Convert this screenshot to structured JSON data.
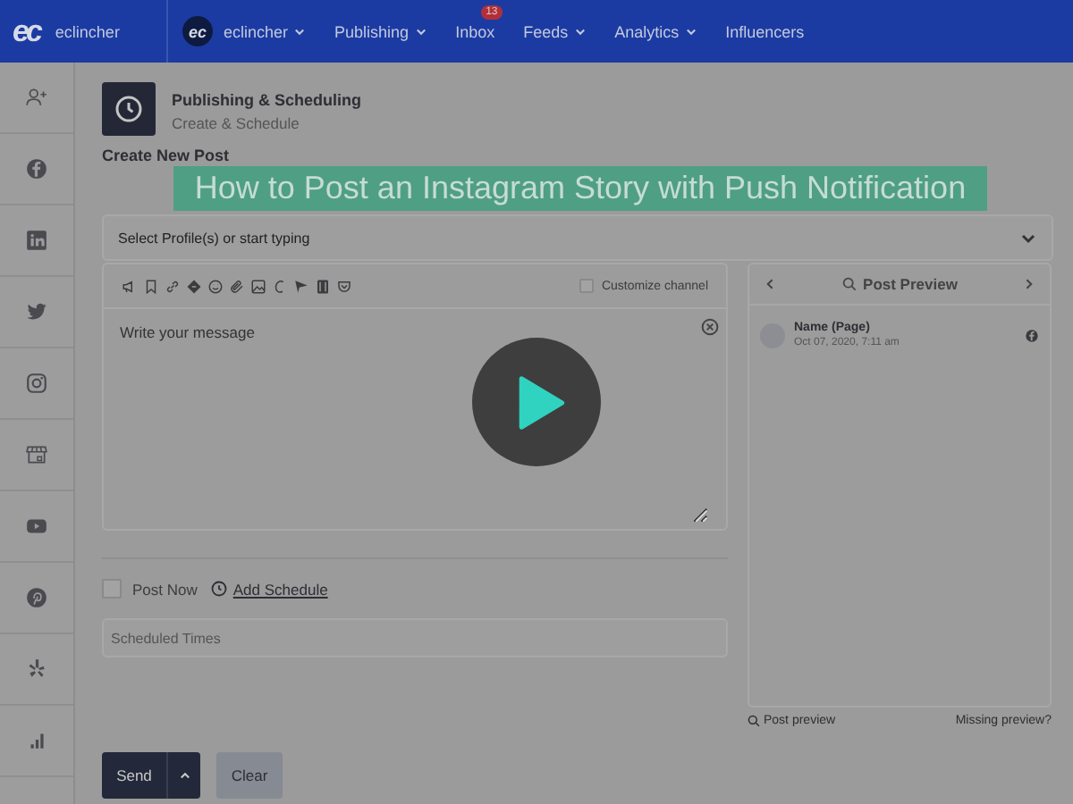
{
  "navbar": {
    "logo": "ec",
    "brand": "eclincher",
    "account": {
      "avatar": "ec",
      "name": "eclincher",
      "has_menu": true
    },
    "items": [
      {
        "label": "Publishing",
        "has_menu": true
      },
      {
        "label": "Inbox",
        "has_menu": false,
        "badge": "13"
      },
      {
        "label": "Feeds",
        "has_menu": true
      },
      {
        "label": "Analytics",
        "has_menu": true
      },
      {
        "label": "Influencers",
        "has_menu": false
      }
    ]
  },
  "sidebar": {
    "items": [
      {
        "kind": "add-user"
      },
      {
        "kind": "facebook"
      },
      {
        "kind": "linkedin"
      },
      {
        "kind": "twitter"
      },
      {
        "kind": "instagram"
      },
      {
        "kind": "store"
      },
      {
        "kind": "youtube"
      },
      {
        "kind": "pinterest"
      },
      {
        "kind": "yelp"
      },
      {
        "kind": "analytics"
      }
    ]
  },
  "page_header": {
    "title": "Publishing & Scheduling",
    "subtitle": "Create & Schedule"
  },
  "section_title": "Create New Post",
  "profile_select": {
    "placeholder": "Select Profile(s) or start typing"
  },
  "composer": {
    "customize_channel": {
      "label": "Customize channel",
      "checked": false
    },
    "message": {
      "placeholder": "Write your message"
    }
  },
  "schedule": {
    "post_now": {
      "label": "Post Now",
      "checked": false
    },
    "add_schedule": "Add Schedule",
    "scheduled_times": {
      "placeholder": "Scheduled Times"
    }
  },
  "preview": {
    "title": "Post Preview",
    "name": "Name (Page)",
    "date": "Oct 07, 2020, 7:11 am",
    "footer_left": "Post preview",
    "footer_right": "Missing preview?"
  },
  "actions": {
    "send": "Send",
    "clear": "Clear"
  },
  "video_overlay": {
    "title": "How to Post an Instagram Story with Push Notification"
  }
}
